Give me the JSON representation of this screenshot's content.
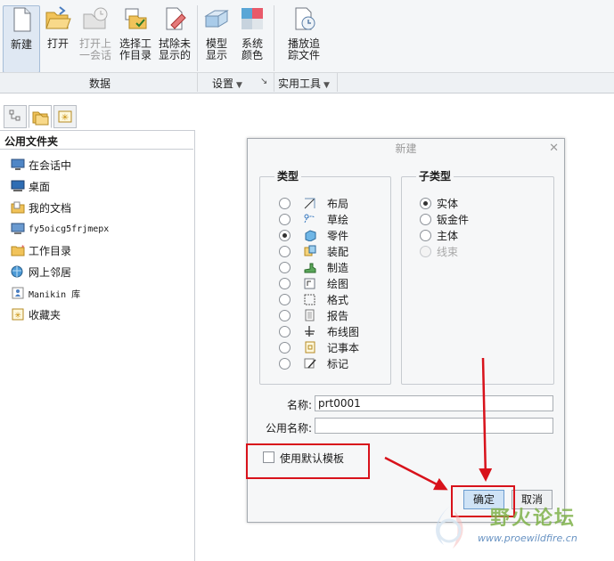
{
  "ribbon": {
    "buttons": [
      {
        "label": "新建",
        "icon": "new-file-icon",
        "state": "active"
      },
      {
        "label": "打开",
        "icon": "open-folder-icon",
        "state": "normal"
      },
      {
        "label": "打开上\n一会话",
        "icon": "open-session-icon",
        "state": "disabled"
      },
      {
        "label": "选择工\n作目录",
        "icon": "working-dir-icon",
        "state": "normal"
      },
      {
        "label": "拭除未\n显示的",
        "icon": "erase-icon",
        "state": "normal"
      },
      {
        "label": "模型\n显示",
        "icon": "model-display-icon",
        "state": "normal"
      },
      {
        "label": "系统\n颜色",
        "icon": "system-color-icon",
        "state": "normal"
      },
      {
        "label": "播放追\n踪文件",
        "icon": "play-trail-icon",
        "state": "normal"
      }
    ],
    "groups": {
      "data": "数据",
      "settings": "设置",
      "tools": "实用工具"
    }
  },
  "navigator": {
    "title": "公用文件夹",
    "items": [
      {
        "label": "在会话中",
        "icon": "session-monitor-icon"
      },
      {
        "label": "桌面",
        "icon": "desktop-icon"
      },
      {
        "label": "我的文档",
        "icon": "documents-icon"
      },
      {
        "label": "fy5oicg5frjmepx",
        "icon": "computer-icon"
      },
      {
        "label": "工作目录",
        "icon": "working-directory-icon"
      },
      {
        "label": "网上邻居",
        "icon": "network-icon"
      },
      {
        "label": "Manikin 库",
        "icon": "manikin-library-icon"
      },
      {
        "label": "收藏夹",
        "icon": "favorites-icon"
      }
    ]
  },
  "dialog": {
    "title": "新建",
    "type_group": {
      "title": "类型",
      "options": [
        {
          "label": "布局",
          "selected": false,
          "icon": "layout-icon"
        },
        {
          "label": "草绘",
          "selected": false,
          "icon": "sketch-icon"
        },
        {
          "label": "零件",
          "selected": true,
          "icon": "part-icon"
        },
        {
          "label": "装配",
          "selected": false,
          "icon": "assembly-icon"
        },
        {
          "label": "制造",
          "selected": false,
          "icon": "manufacturing-icon"
        },
        {
          "label": "绘图",
          "selected": false,
          "icon": "drawing-icon"
        },
        {
          "label": "格式",
          "selected": false,
          "icon": "format-icon"
        },
        {
          "label": "报告",
          "selected": false,
          "icon": "report-icon"
        },
        {
          "label": "布线图",
          "selected": false,
          "icon": "diagram-icon"
        },
        {
          "label": "记事本",
          "selected": false,
          "icon": "notebook-icon"
        },
        {
          "label": "标记",
          "selected": false,
          "icon": "markup-icon"
        }
      ]
    },
    "subtype_group": {
      "title": "子类型",
      "options": [
        {
          "label": "实体",
          "selected": true,
          "enabled": true
        },
        {
          "label": "钣金件",
          "selected": false,
          "enabled": true
        },
        {
          "label": "主体",
          "selected": false,
          "enabled": true
        },
        {
          "label": "线束",
          "selected": false,
          "enabled": false
        }
      ]
    },
    "name_label": "名称:",
    "name_value": "prt0001",
    "common_name_label": "公用名称:",
    "common_name_value": "",
    "use_default_template_label": "使用默认模板",
    "use_default_template_checked": false,
    "ok_label": "确定",
    "cancel_label": "取消"
  },
  "watermark": {
    "text": "野火论坛",
    "url": "www.proewildfire.cn"
  },
  "colors": {
    "annotation_red": "#d8121b",
    "primary_button": "#cfe3f6",
    "watermark_green": "#7fb24a"
  }
}
